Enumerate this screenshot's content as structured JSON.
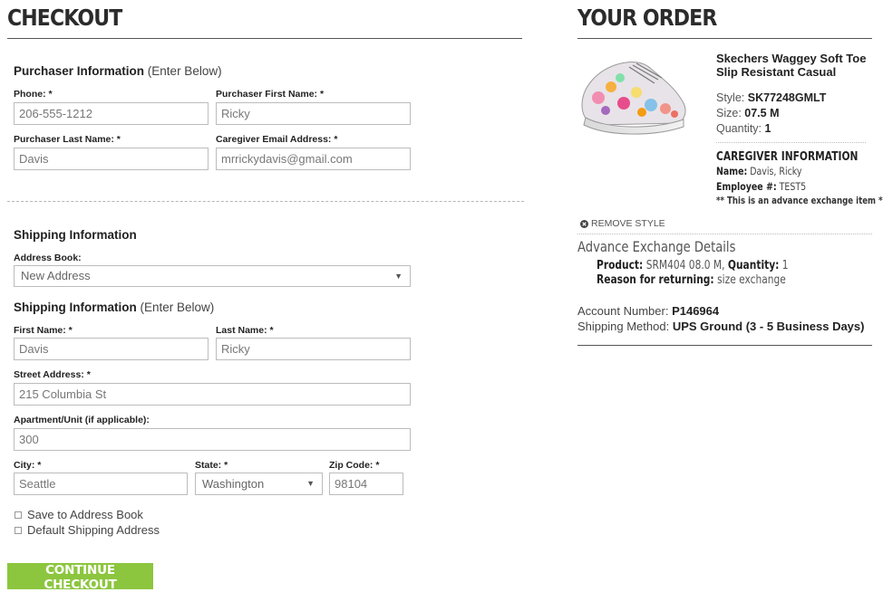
{
  "checkout": {
    "title": "CHECKOUT",
    "purchaser": {
      "heading": "Purchaser Information",
      "heading_sub": "(Enter Below)",
      "phone_label": "Phone: *",
      "phone_value": "206-555-1212",
      "first_name_label": "Purchaser First Name: *",
      "first_name_value": "Ricky",
      "last_name_label": "Purchaser Last Name: *",
      "last_name_value": "Davis",
      "email_label": "Caregiver Email Address: *",
      "email_value": "mrrickydavis@gmail.com"
    },
    "shipping": {
      "heading": "Shipping Information",
      "address_book_label": "Address Book:",
      "address_book_value": "New Address",
      "enter_heading": "Shipping Information",
      "enter_heading_sub": "(Enter Below)",
      "first_name_label": "First Name: *",
      "first_name_value": "Davis",
      "last_name_label": "Last Name: *",
      "last_name_value": "Ricky",
      "street_label": "Street Address: *",
      "street_value": "215 Columbia St",
      "apt_label": "Apartment/Unit (if applicable):",
      "apt_value": "300",
      "city_label": "City: *",
      "city_value": "Seattle",
      "state_label": "State: *",
      "state_value": "Washington",
      "zip_label": "Zip Code: *",
      "zip_value": "98104",
      "save_address_label": "Save to Address Book",
      "default_address_label": "Default Shipping Address"
    },
    "continue_label": "CONTINUE CHECKOUT"
  },
  "order": {
    "title": "YOUR ORDER",
    "product_name": "Skechers Waggey Soft Toe Slip Resistant Casual",
    "style_label": "Style:",
    "style_value": "SK77248GMLT",
    "size_label": "Size:",
    "size_value": "07.5 M",
    "quantity_label": "Quantity:",
    "quantity_value": "1",
    "caregiver_heading": "CAREGIVER INFORMATION",
    "name_label": "Name:",
    "name_value": "Davis, Ricky",
    "employee_label": "Employee #:",
    "employee_value": "TEST5",
    "advance_note": "** This is an advance exchange item **",
    "remove_label": "REMOVE STYLE",
    "exchange_heading": "Advance Exchange Details",
    "product_label": "Product:",
    "product_value": "SRM404 08.0 M,",
    "ex_quantity_label": "Quantity:",
    "ex_quantity_value": "1",
    "reason_label": "Reason for returning:",
    "reason_value": "size exchange",
    "account_label": "Account Number:",
    "account_value": "P146964",
    "shipping_method_label": "Shipping Method:",
    "shipping_method_value": "UPS Ground (3 - 5 Business Days)"
  },
  "colors": {
    "button_green": "#8cc63f",
    "heading": "#2b2b2b"
  },
  "icons": {
    "remove": "remove-circle-icon",
    "dropdown": "chevron-down-icon",
    "checkbox": "checkbox-icon"
  }
}
